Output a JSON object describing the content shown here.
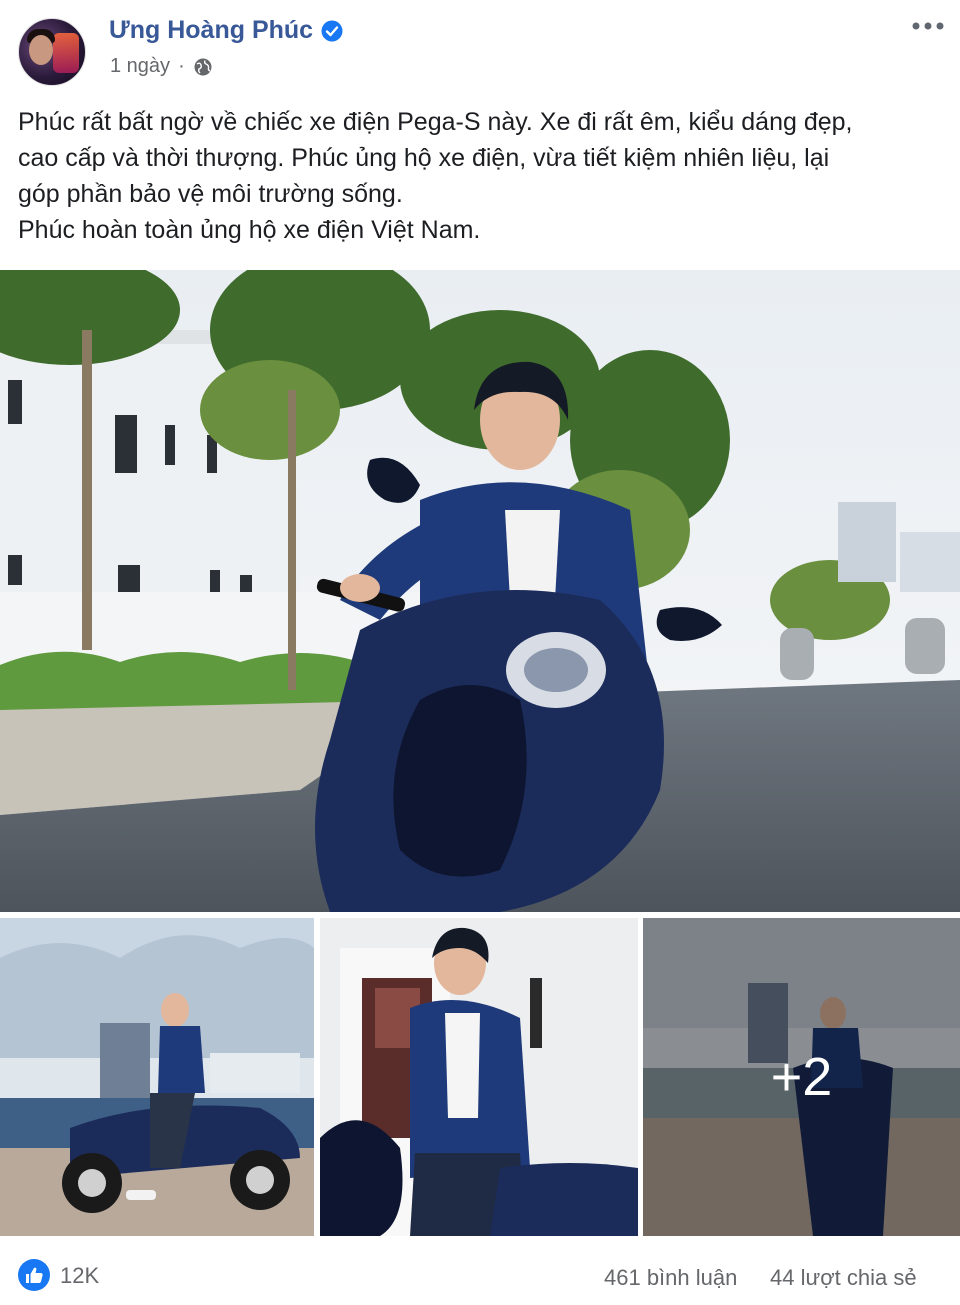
{
  "post": {
    "author": "Ưng Hoàng Phúc",
    "time": "1 ngày",
    "time_separator": "·",
    "text_lines": [
      "Phúc rất bất ngờ về chiếc xe điện Pega-S này. Xe đi rất êm, kiểu dáng đẹp,",
      "cao cấp và thời thượng. Phúc ủng hộ xe điện, vừa tiết kiệm nhiên liệu, lại",
      "góp phần bảo vệ môi trường sống.",
      "Phúc hoàn toàn ủng hộ xe điện Việt Nam."
    ],
    "more_photos_label": "+2"
  },
  "stats": {
    "likes": "12K",
    "comments": "461 bình luận",
    "shares": "44 lượt chia sẻ"
  },
  "colors": {
    "name_blue": "#385898",
    "verified_blue": "#1877f2",
    "meta_gray": "#65676b",
    "scooter_blue": "#1c2c5a"
  },
  "icons": {
    "verified": "verified-badge-icon",
    "privacy": "globe-icon",
    "menu": "more-options-icon",
    "reaction": "like-reaction-icon"
  }
}
